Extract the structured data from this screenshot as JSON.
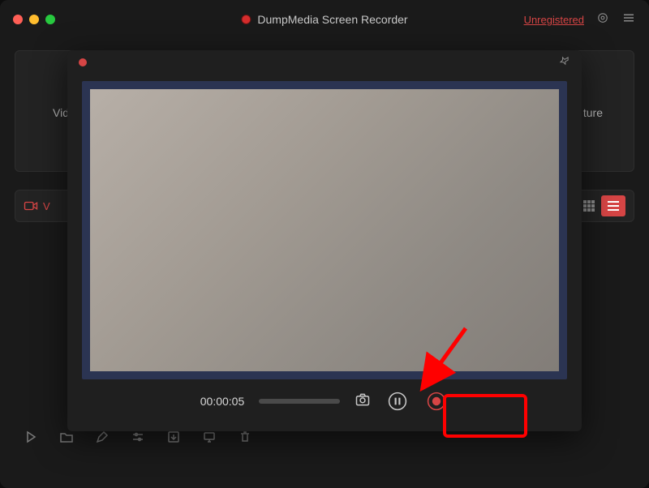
{
  "titlebar": {
    "app_title": "DumpMedia Screen Recorder",
    "unregistered_label": "Unregistered"
  },
  "top_panel": {
    "left_label": "Video",
    "right_label": "ture"
  },
  "mid_bar": {
    "videos_label": "V"
  },
  "record_panel": {
    "timer": "00:00:05"
  },
  "icons": {
    "settings": "gear",
    "menu": "hamburger",
    "pin": "pin",
    "camera": "camera",
    "pause": "pause",
    "stop": "stop",
    "play": "play",
    "folder": "folder",
    "pencil": "pencil",
    "sliders": "sliders",
    "download": "download",
    "screen": "screen",
    "trash": "trash",
    "grid": "grid",
    "list": "list",
    "camcorder": "camcorder"
  },
  "colors": {
    "accent_red": "#d64545",
    "annotation_red": "#ff0000",
    "preview_border": "#2b3452"
  }
}
